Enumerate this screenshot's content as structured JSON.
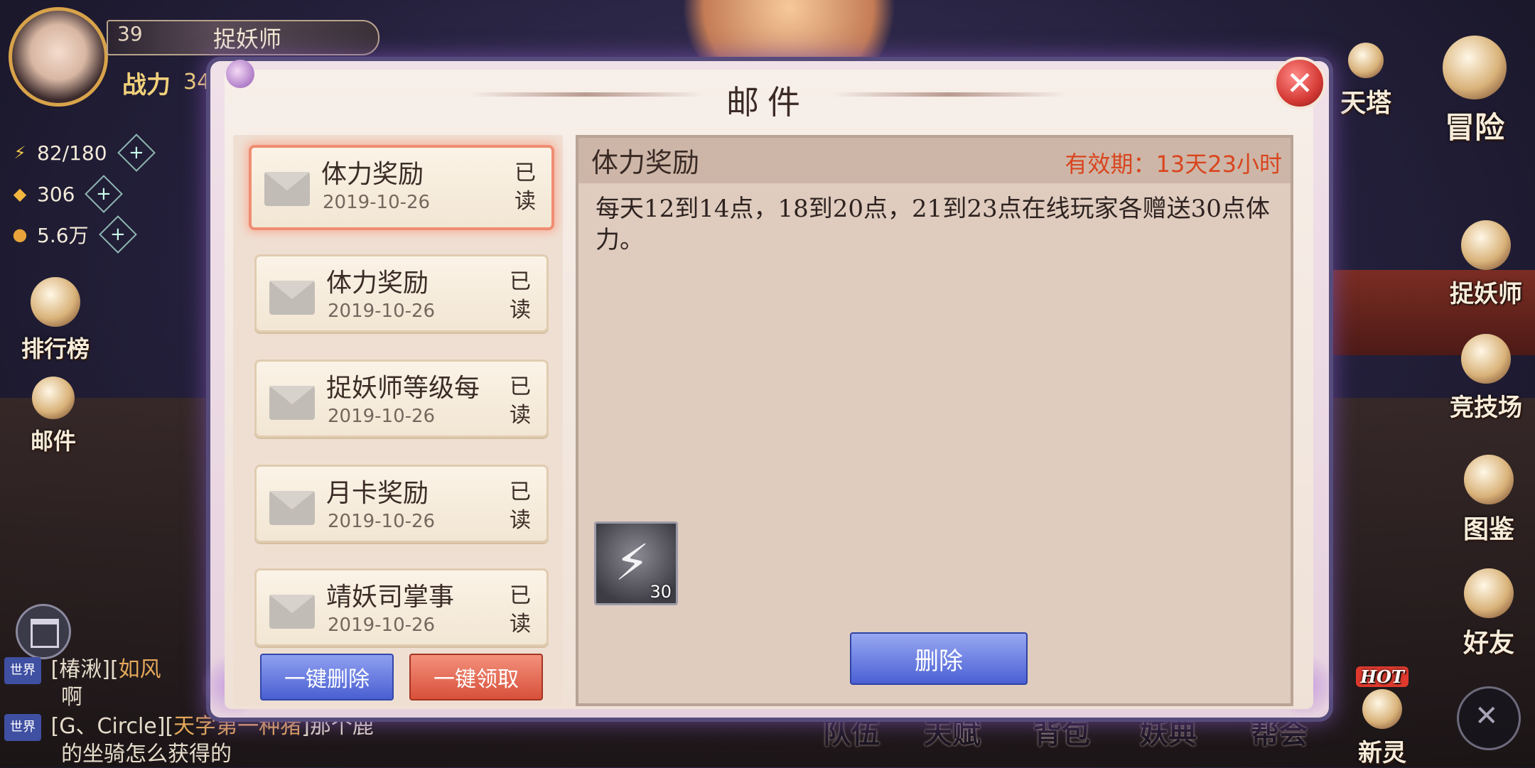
{
  "player": {
    "level": "39",
    "name": "捉妖师",
    "power_label": "战力",
    "power_value": "34"
  },
  "resources": [
    {
      "icon": "lightning-icon",
      "value": "82/180"
    },
    {
      "icon": "gold-ingot-icon",
      "value": "306"
    },
    {
      "icon": "coin-icon",
      "value": "5.6万"
    }
  ],
  "left_menu": [
    {
      "icon": "ranking-icon",
      "label": "排行榜"
    },
    {
      "icon": "mail-icon",
      "label": "邮件"
    }
  ],
  "right_menu": [
    {
      "icon": "tower-icon",
      "label": "天塔"
    },
    {
      "icon": "adventure-icon",
      "label": "冒险"
    },
    {
      "icon": "demon-hunter-icon",
      "label": "捉妖师"
    },
    {
      "icon": "arena-icon",
      "label": "竞技场"
    },
    {
      "icon": "codex-icon",
      "label": "图鉴"
    },
    {
      "icon": "friends-icon",
      "label": "好友"
    },
    {
      "icon": "new-spirit-icon",
      "label": "新灵",
      "badge": "HOT"
    }
  ],
  "bottom_tabs": [
    "队伍",
    "天赋",
    "背包",
    "妖典",
    "帮会"
  ],
  "chat": [
    {
      "channel": "世界",
      "line1_prefix": "[椿湫][",
      "line1_highlight": "如风",
      "line2": "啊"
    },
    {
      "channel": "世界",
      "line1_prefix": "[G、Circle][",
      "line1_highlight": "天字第一种猪",
      "line1_suffix": "]那个鹿",
      "line2": "的坐骑怎么获得的"
    }
  ],
  "modal": {
    "title": "邮件",
    "close_icon": "close-icon",
    "mails": [
      {
        "title": "体力奖励",
        "date": "2019-10-26",
        "status": "已读",
        "selected": true
      },
      {
        "title": "体力奖励",
        "date": "2019-10-26",
        "status": "已读"
      },
      {
        "title": "捉妖师等级每",
        "date": "2019-10-26",
        "status": "已读"
      },
      {
        "title": "月卡奖励",
        "date": "2019-10-26",
        "status": "已读"
      },
      {
        "title": "靖妖司掌事",
        "date": "2019-10-26",
        "status": "已读"
      }
    ],
    "delete_all_label": "一键删除",
    "claim_all_label": "一键领取",
    "detail": {
      "title": "体力奖励",
      "expiry": "有效期：13天23小时",
      "body": "每天12到14点，18到20点，21到23点在线玩家各赠送30点体力。",
      "reward": {
        "icon": "stamina-bolt-icon",
        "count": "30"
      },
      "delete_label": "删除"
    }
  },
  "colors": {
    "expiry": "#d9451f",
    "selected_border": "#ef8d72",
    "blue_button": "#4a5fd2",
    "red_button": "#d8503a"
  }
}
